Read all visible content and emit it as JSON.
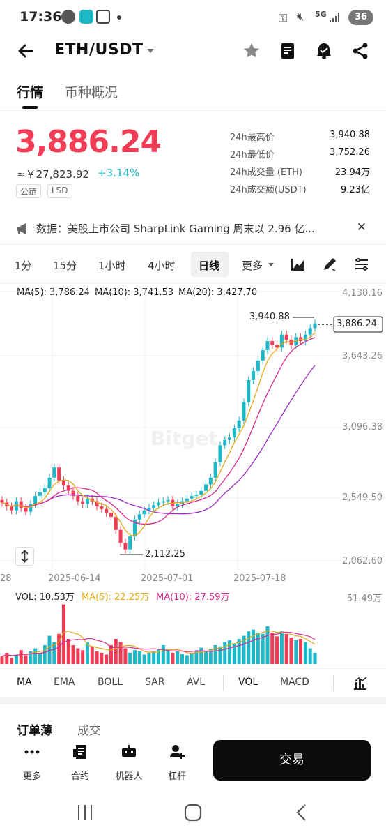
{
  "status_bar": {
    "time": "17:36",
    "network": "5G",
    "battery": "36"
  },
  "header": {
    "title": "ETH/USDT"
  },
  "top_tabs": [
    "行情",
    "币种概况"
  ],
  "price": {
    "last": "3,886.24",
    "cny": "≈￥27,823.92",
    "change": "+3.14%",
    "tags": [
      "公链",
      "LSD"
    ],
    "stats": [
      {
        "label": "24h最高价",
        "value": "3,940.88"
      },
      {
        "label": "24h最低价",
        "value": "3,752.26"
      },
      {
        "label": "24h成交量 (ETH)",
        "value": "23.94万"
      },
      {
        "label": "24h成交额(USDT)",
        "value": "9.23亿"
      }
    ]
  },
  "news": {
    "text": "数据：美股上市公司 SharpLink Gaming 周末以 2.96 亿..."
  },
  "intervals": [
    "1分",
    "15分",
    "1小时",
    "4小时",
    "日线",
    "更多"
  ],
  "interval_active": "日线",
  "chart": {
    "ma_legend": [
      {
        "label": "MA(5): 3,786.24",
        "color": "#e6a817"
      },
      {
        "label": "MA(10): 3,741.53",
        "color": "#d6288e"
      },
      {
        "label": "MA(20): 3,427.70",
        "color": "#9b2bc4"
      }
    ],
    "y_ticks": [
      "4,130.16",
      "3,643.26",
      "3,096.38",
      "2,549.50",
      "2,062.60"
    ],
    "x_ticks": [
      "28",
      "2025-06-14",
      "2025-07-01",
      "2025-07-18"
    ],
    "high_label": "3,940.88",
    "low_label": "2,112.25",
    "last_label": "3,886.24",
    "watermark": "Bitget"
  },
  "volume": {
    "legend": [
      {
        "label": "VOL: 10.53万",
        "color": "#222"
      },
      {
        "label": "MA(5): 22.25万",
        "color": "#e6a817"
      },
      {
        "label": "MA(10): 27.59万",
        "color": "#d6288e"
      }
    ],
    "max_label": "51.49万"
  },
  "indicator_tabs": [
    "MA",
    "EMA",
    "BOLL",
    "SAR",
    "AVL",
    "VOL",
    "MACD"
  ],
  "bottom": {
    "tabs": [
      "订单薄",
      "成交"
    ],
    "actions": [
      "更多",
      "合约",
      "机器人",
      "杠杆"
    ],
    "trade_label": "交易"
  },
  "colors": {
    "up": "#1fb8c8",
    "down": "#f03c54",
    "accent": "#111111"
  }
}
